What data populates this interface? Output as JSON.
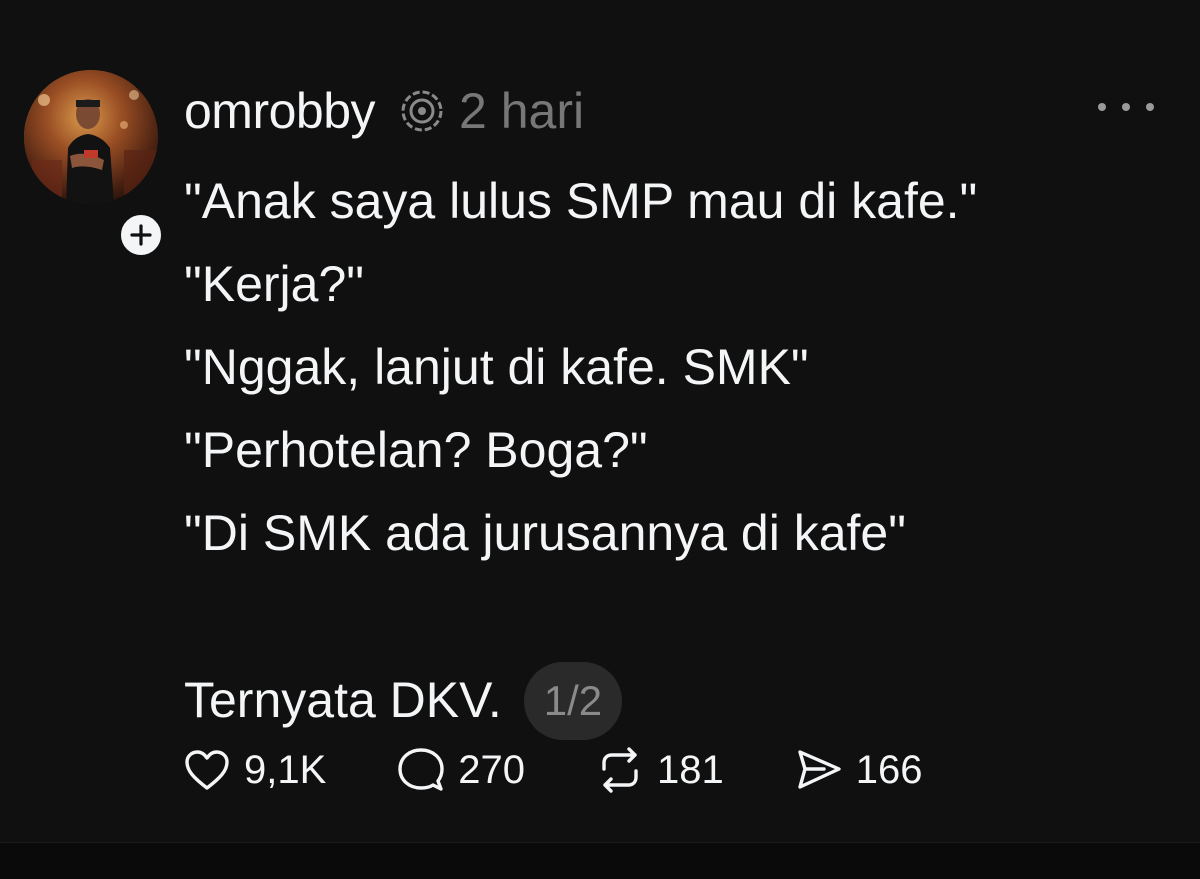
{
  "post": {
    "username": "omrobby",
    "timestamp": "2 hari",
    "lines": [
      "\"Anak saya lulus SMP mau di kafe.\"",
      "\"Kerja?\"",
      "\"Nggak, lanjut di kafe. SMK\"",
      "\"Perhotelan? Boga?\"",
      "\"Di SMK ada jurusannya di kafe\""
    ],
    "final_line": "Ternyata DKV.",
    "page_indicator": "1/2"
  },
  "actions": {
    "like_count": "9,1K",
    "reply_count": "270",
    "repost_count": "181",
    "share_count": "166"
  },
  "icons": {
    "header_icon": "threads-circle-icon",
    "more": "more-horizontal-icon",
    "follow": "plus-icon",
    "like": "heart-icon",
    "reply": "comment-bubble-icon",
    "repost": "repost-icon",
    "share": "send-icon"
  },
  "colors": {
    "background": "#101010",
    "text": "#f3f5f7",
    "muted": "#777777"
  }
}
